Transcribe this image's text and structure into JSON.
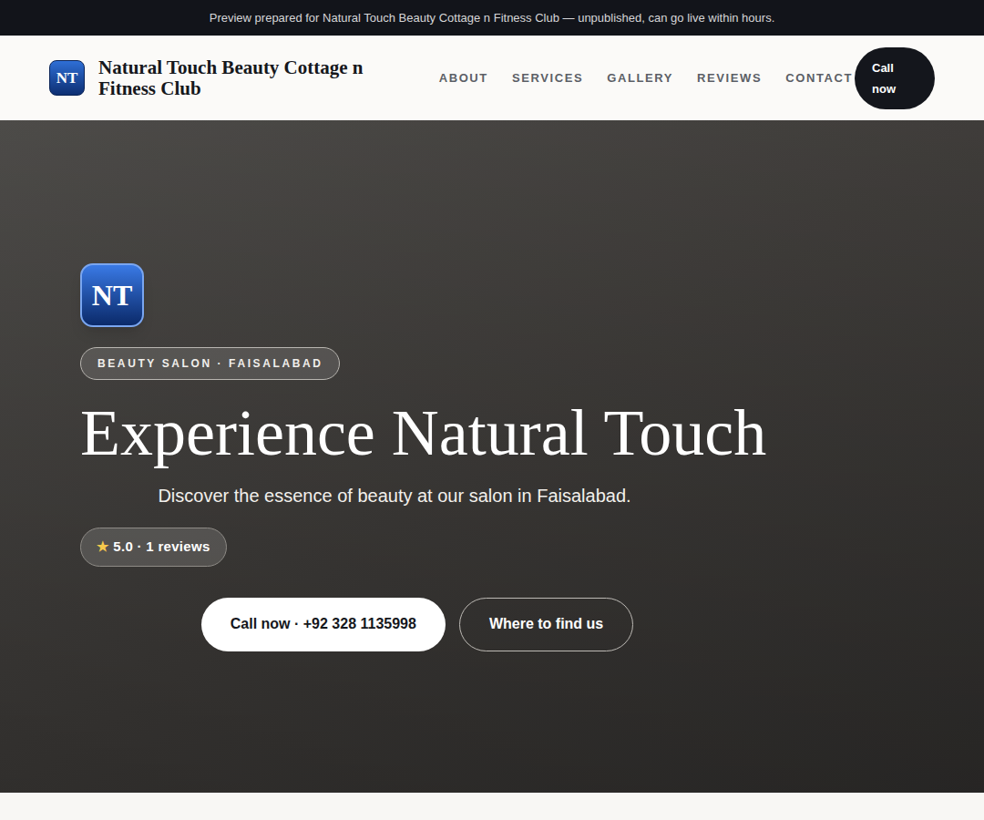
{
  "banner": {
    "text": "Preview prepared for Natural Touch Beauty Cottage n Fitness Club — unpublished, can go live within hours."
  },
  "header": {
    "logo": "NT",
    "brand": "Natural Touch Beauty Cottage n Fitness Club",
    "nav": [
      {
        "label": "ABOUT"
      },
      {
        "label": "SERVICES"
      },
      {
        "label": "GALLERY"
      },
      {
        "label": "REVIEWS"
      },
      {
        "label": "CONTACT"
      }
    ],
    "call_button": "Call now"
  },
  "hero": {
    "logo": "NT",
    "badge": "BEAUTY SALON · FAISALABAD",
    "title": "Experience Natural Touch",
    "subtitle": "Discover the essence of beauty at our salon in Faisalabad.",
    "rating": {
      "star": "★",
      "text": "5.0 · 1 reviews"
    },
    "buttons": [
      {
        "label": "Call now · +92 328 1135998",
        "kind": "primary"
      },
      {
        "label": "Where to find us",
        "kind": "outline"
      }
    ]
  }
}
